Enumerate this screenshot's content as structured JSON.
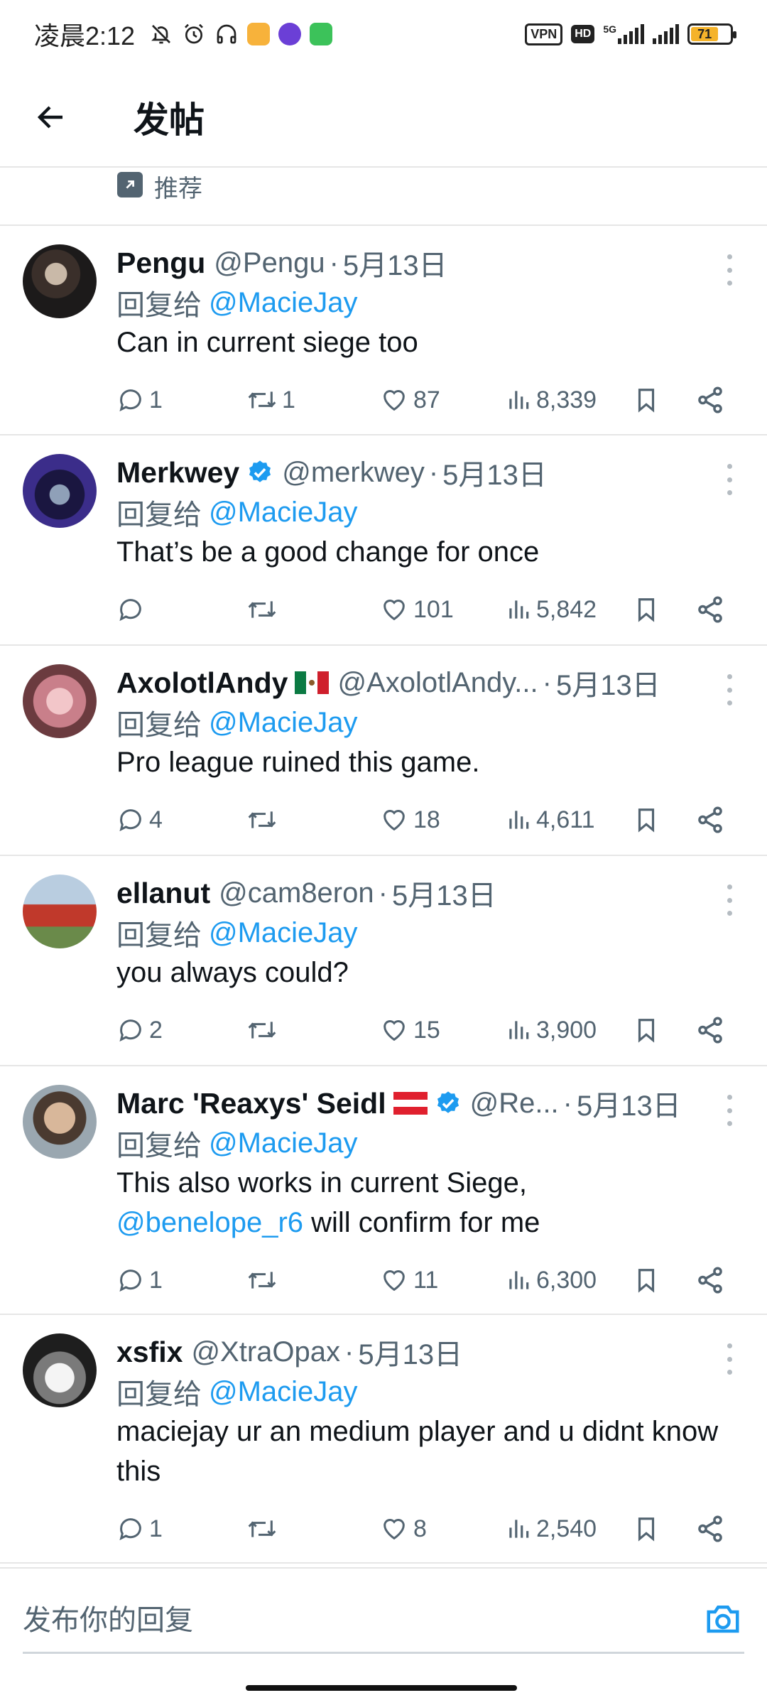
{
  "status_bar": {
    "time": "凌晨2:12",
    "vpn": "VPN",
    "hd": "HD",
    "network": "5G",
    "battery": "71"
  },
  "header": {
    "title": "发帖"
  },
  "recommend": {
    "label": "推荐"
  },
  "reply_prefix": "回复给",
  "replies": [
    {
      "name": "Pengu",
      "handle": "@Pengu",
      "date": "5月13日",
      "reply_to": "@MacieJay",
      "text": "Can in current siege too",
      "replies": "1",
      "retweets": "1",
      "likes": "87",
      "views": "8,339",
      "verified": false,
      "flag": ""
    },
    {
      "name": "Merkwey",
      "handle": "@merkwey",
      "date": "5月13日",
      "reply_to": "@MacieJay",
      "text": "That’s be a good change for once",
      "replies": "",
      "retweets": "",
      "likes": "101",
      "views": "5,842",
      "verified": true,
      "flag": ""
    },
    {
      "name": "AxolotlAndy",
      "handle": "@AxolotlAndy...",
      "date": "5月13日",
      "reply_to": "@MacieJay",
      "text": "Pro league ruined this game.",
      "replies": "4",
      "retweets": "",
      "likes": "18",
      "views": "4,611",
      "verified": false,
      "flag": "mexico"
    },
    {
      "name": "ellanut",
      "handle": "@cam8eron",
      "date": "5月13日",
      "reply_to": "@MacieJay",
      "text": "you always could?",
      "replies": "2",
      "retweets": "",
      "likes": "15",
      "views": "3,900",
      "verified": false,
      "flag": ""
    },
    {
      "name": "Marc 'Reaxys' Seidl",
      "handle": "@Re...",
      "date": "5月13日",
      "reply_to": "@MacieJay",
      "text_line1": "This also works in current Siege,",
      "text_mention": "@benelope_r6",
      "text_rest": " will confirm for me",
      "replies": "1",
      "retweets": "",
      "likes": "11",
      "views": "6,300",
      "verified": true,
      "flag": "austria"
    },
    {
      "name": "xsfix",
      "handle": "@XtraOpax",
      "date": "5月13日",
      "reply_to": "@MacieJay",
      "text": "maciejay ur an medium player and u didnt know this",
      "replies": "1",
      "retweets": "",
      "likes": "8",
      "views": "2,540",
      "verified": false,
      "flag": ""
    }
  ],
  "composer": {
    "placeholder": "发布你的回复"
  },
  "colors": {
    "accent": "#1d9bf0",
    "secondary_text": "#536471",
    "divider": "#e6e6e6"
  }
}
